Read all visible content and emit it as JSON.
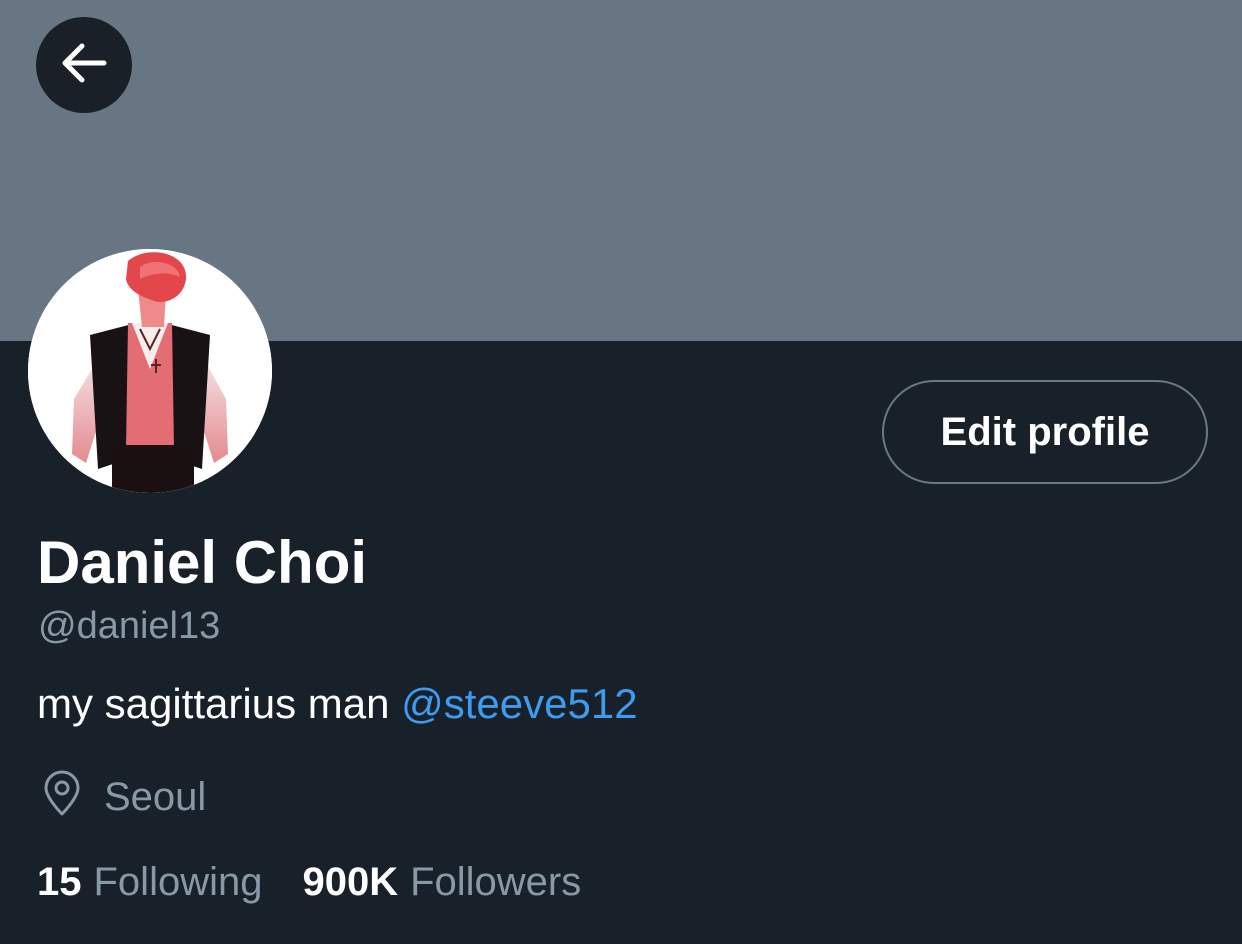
{
  "profile": {
    "name": "Daniel Choi",
    "handle": "@daniel13",
    "bio_text": "my sagittarius man ",
    "bio_mention": "@steeve512",
    "location": "Seoul",
    "edit_label": "Edit profile"
  },
  "stats": {
    "following_count": "15",
    "following_label": "Following",
    "followers_count": "900K",
    "followers_label": "Followers"
  },
  "icons": {
    "back": "arrow-left-icon",
    "location": "location-pin-icon"
  },
  "colors": {
    "banner": "#687684",
    "background": "#182029",
    "mention": "#3d9bf0",
    "secondary_text": "#8899a6"
  }
}
